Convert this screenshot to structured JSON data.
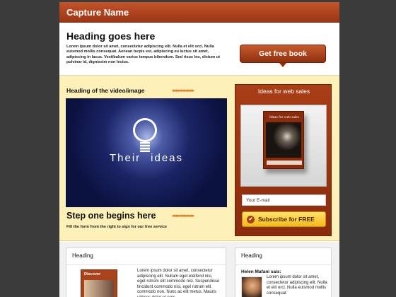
{
  "header": {
    "title": "Capture Name"
  },
  "hero": {
    "heading": "Heading goes here",
    "body": "Lorem ipsum dolor sit amet, consectetur adipiscing elit. Nulla et elit orci. Nulla euismod mollis consequat. Aenean turpis est, adipiscing eu luctus sit amet, adipiscing in lacus. Vestibulum varius tempus bibendum. Sed risus leo, dictum ut pulvinar id, dignissim non lectus.",
    "cta_label": "Get free book"
  },
  "video_section": {
    "heading": "Heading of the video/image",
    "video_text_left": "Their",
    "video_text_right": "ideas",
    "step_heading": "Step one begins here",
    "step_sub": "Fill the form from the right to sign for our free service"
  },
  "signup": {
    "title": "Ideas for web sales",
    "book_title": "Ideas for web sales",
    "email_value": "Your E-mail",
    "subscribe_label": "Subscribe for FREE"
  },
  "cards": {
    "left": {
      "title": "Heading",
      "book_label": "Discover",
      "body": "Lorem ipsum dolor sit amet, consectetur adipiscing elit. Nullam eget eleifend nisi, eget rutrum elit commodo nisi. Suspendisse tincidunt commodo nisi, eget rutrum elit commodo non. Nunc ac elit metus. Mauris ultrices dolor et eros"
    },
    "right": {
      "title": "Heading",
      "author": "Helen Mafani sais:",
      "body": "Lorem ipsum dolor sit amet, consectetur adipiscing elit. Nulla et elit orci. Nulla euismod mollis consequat."
    }
  },
  "colors": {
    "accent": "#9c3514",
    "band": "#fdf0b8",
    "button_yellow": "#f4b81a",
    "background": "#3b3b3b"
  },
  "icons": {
    "bullet": "check-icon",
    "arrows": "double-chevron-right-icon"
  }
}
